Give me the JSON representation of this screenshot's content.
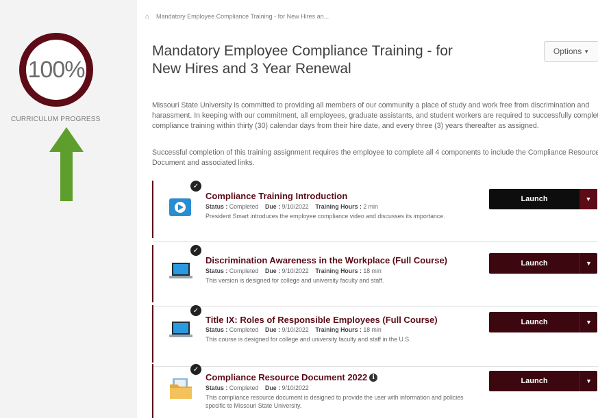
{
  "sidebar": {
    "progress_value": "100%",
    "progress_fraction": 1.0,
    "progress_label": "CURRICULUM PROGRESS"
  },
  "breadcrumb": {
    "home_icon": "home-icon",
    "text": "Mandatory Employee Compliance Training - for New Hires an..."
  },
  "header": {
    "title": "Mandatory Employee Compliance Training - for New Hires and 3 Year Renewal",
    "options_label": "Options"
  },
  "description": {
    "p1": "Missouri State University is committed to providing all members of our community a place of study and work free from discrimination and harassment. In keeping with our commitment, all employees, graduate assistants, and student workers are required to successfully complete compliance training within thirty (30) calendar days from their hire date, and every three (3) years thereafter as assigned.",
    "p2": "Successful completion of this training assignment requires the employee to complete all 4 components to include the Compliance Resource Document and associated links."
  },
  "labels": {
    "status": "Status :",
    "due": "Due :",
    "hours": "Training Hours :"
  },
  "items": [
    {
      "title": "Compliance Training Introduction",
      "status": "Completed",
      "due": "9/10/2022",
      "hours": "2 min",
      "description": "President Smart introduces the employee compliance video and discusses its importance.",
      "icon": "video-play-icon",
      "launch_label": "Launch"
    },
    {
      "title": "Discrimination Awareness in the Workplace (Full Course)",
      "status": "Completed",
      "due": "9/10/2022",
      "hours": "18 min",
      "description": "This version is designed for college and university faculty and staff.",
      "icon": "laptop-icon",
      "launch_label": "Launch"
    },
    {
      "title": "Title IX: Roles of Responsible Employees (Full Course)",
      "status": "Completed",
      "due": "9/10/2022",
      "hours": "18 min",
      "description": "This course is designed for college and university faculty and staff in the U.S.",
      "icon": "laptop-icon",
      "launch_label": "Launch"
    },
    {
      "title": "Compliance Resource Document 2022",
      "status": "Completed",
      "due": "9/10/2022",
      "description": "This compliance resource document is designed to provide the user with information and policies specific to Missouri State University.",
      "icon": "folder-document-icon",
      "launch_label": "Launch"
    }
  ],
  "colors": {
    "brand": "#5c0b17",
    "launch_button": "#3d0710",
    "arrow": "#5e9e2c"
  }
}
